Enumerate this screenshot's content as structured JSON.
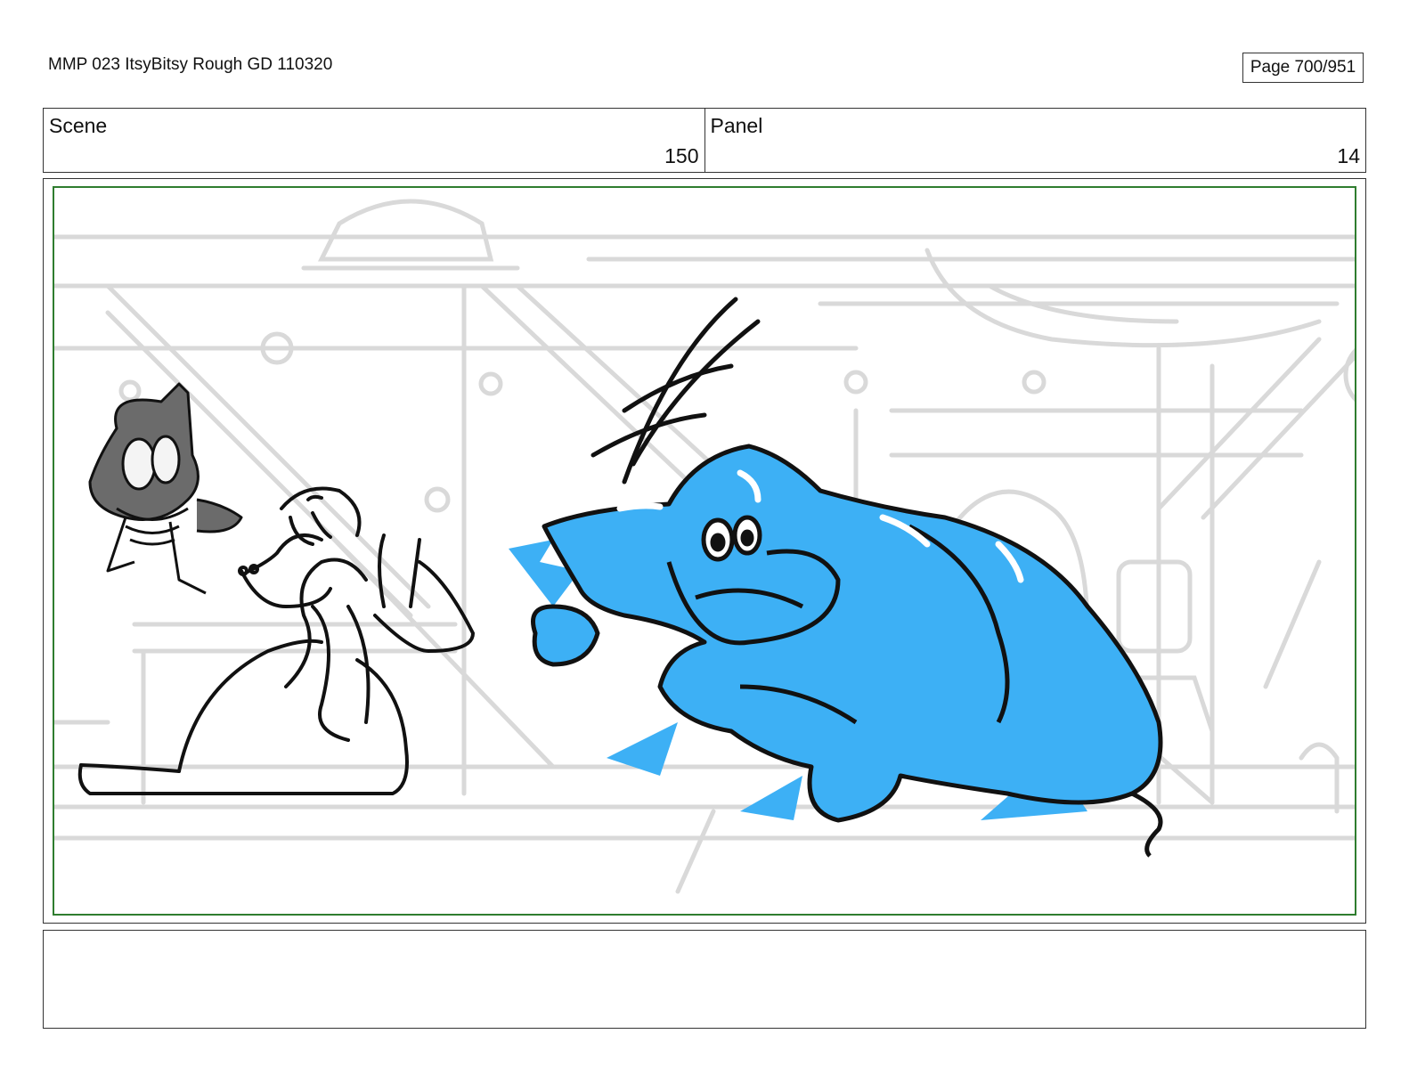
{
  "document": {
    "title": "MMP 023 ItsyBitsy Rough GD 110320",
    "page_label": "Page 700/951"
  },
  "header": {
    "scene_label": "Scene",
    "scene_value": "150",
    "panel_label": "Panel",
    "panel_value": "14"
  },
  "colors": {
    "safe_frame": "#2f7d2f",
    "blue_character": "#3db0f5",
    "gray_character": "#6b6b6b",
    "background_lines": "#d9d9d9"
  },
  "notes": {
    "text": ""
  }
}
